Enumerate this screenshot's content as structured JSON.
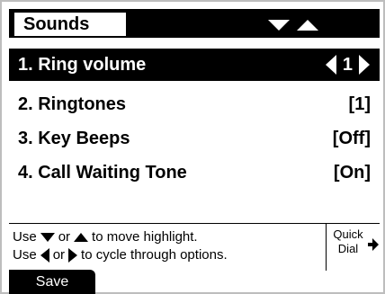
{
  "header": {
    "title": "Sounds",
    "nav_icons": [
      "arrow-down-icon",
      "arrow-up-icon"
    ]
  },
  "menu": [
    {
      "label": "1. Ring volume",
      "value": "1",
      "selected": true
    },
    {
      "label": "2. Ringtones",
      "value": "[1]"
    },
    {
      "label": "3. Key Beeps",
      "value": "[Off]"
    },
    {
      "label": "4. Call Waiting Tone",
      "value": "[On]"
    }
  ],
  "help": {
    "line1_a": "Use",
    "line1_b": "or",
    "line1_c": "to move highlight.",
    "line2_a": "Use",
    "line2_b": "or",
    "line2_c": "to cycle through options."
  },
  "quick_dial": {
    "line1": "Quick",
    "line2": "Dial"
  },
  "softkeys": {
    "save": "Save"
  }
}
